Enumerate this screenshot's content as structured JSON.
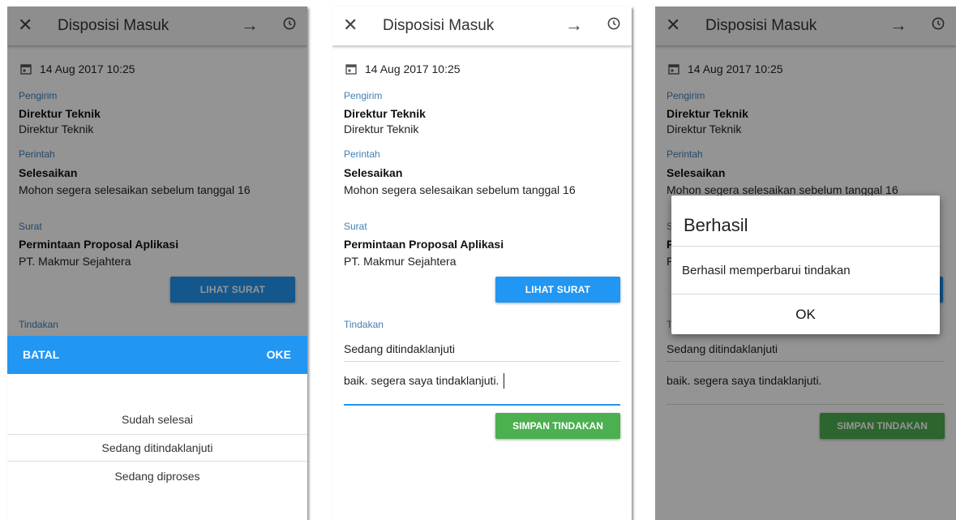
{
  "appbar": {
    "title": "Disposisi Masuk",
    "close_glyph": "✕",
    "forward_glyph": "→"
  },
  "detail": {
    "date": "14 Aug 2017 10:25",
    "pengirim_label": "Pengirim",
    "pengirim_name": "Direktur Teknik",
    "pengirim_position": "Direktur Teknik",
    "perintah_label": "Perintah",
    "perintah_title": "Selesaikan",
    "perintah_note": "Mohon segera selesaikan sebelum tanggal 16",
    "surat_label": "Surat",
    "surat_title": "Permintaan Proposal Aplikasi",
    "surat_company": "PT. Makmur Sejahtera",
    "lihat_surat_label": "LIHAT SURAT",
    "tindakan_label": "Tindakan",
    "tindakan_value": "Sedang ditindaklanjuti",
    "note_value": "baik. segera saya tindaklanjuti.",
    "simpan_label": "SIMPAN TINDAKAN"
  },
  "picker": {
    "cancel_label": "BATAL",
    "ok_label": "OKE",
    "options": [
      "Sudah selesai",
      "Sedang ditindaklanjuti",
      "Sedang diproses"
    ]
  },
  "dialog": {
    "title": "Berhasil",
    "message": "Berhasil memperbarui tindakan",
    "ok_label": "OK"
  },
  "colors": {
    "accent": "#2196f3",
    "success": "#4caf50",
    "label": "#3f7fb4"
  },
  "icons": [
    "close-icon",
    "arrow-forward-icon",
    "history-icon",
    "calendar-icon"
  ]
}
